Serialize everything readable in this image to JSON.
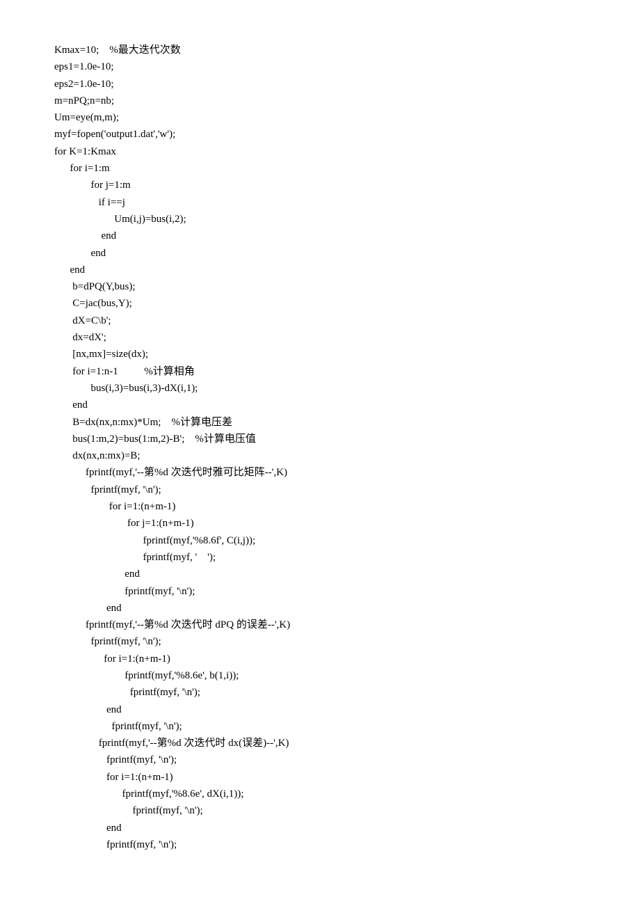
{
  "lines": [
    "Kmax=10;    %最大迭代次数",
    "eps1=1.0e-10;",
    "eps2=1.0e-10;",
    "m=nPQ;n=nb;",
    "Um=eye(m,m);",
    "myf=fopen('output1.dat','w');",
    "for K=1:Kmax",
    "      for i=1:m",
    "              for j=1:m",
    "                 if i==j",
    "                       Um(i,j)=bus(i,2);",
    "                  end",
    "              end",
    "      end",
    "       b=dPQ(Y,bus);",
    "       C=jac(bus,Y);",
    "       dX=C\\b';",
    "       dx=dX';",
    "       [nx,mx]=size(dx);",
    "       for i=1:n-1          %计算相角",
    "              bus(i,3)=bus(i,3)-dX(i,1);",
    "       end",
    "       B=dx(nx,n:mx)*Um;    %计算电压差",
    "       bus(1:m,2)=bus(1:m,2)-B';    %计算电压值",
    "       dx(nx,n:mx)=B;",
    "            fprintf(myf,'--第%d 次迭代时雅可比矩阵--',K)",
    "              fprintf(myf, '\\n');",
    "                     for i=1:(n+m-1)",
    "                            for j=1:(n+m-1)",
    "                                  fprintf(myf,'%8.6f', C(i,j));",
    "                                  fprintf(myf, '    ');",
    "                           end",
    "                           fprintf(myf, '\\n');",
    "                    end",
    "            fprintf(myf,'--第%d 次迭代时 dPQ 的误差--',K)",
    "              fprintf(myf, '\\n');",
    "                   for i=1:(n+m-1)",
    "                           fprintf(myf,'%8.6e', b(1,i));",
    "                             fprintf(myf, '\\n');",
    "                    end",
    "                      fprintf(myf, '\\n');",
    "                 fprintf(myf,'--第%d 次迭代时 dx(误差)--',K)",
    "                    fprintf(myf, '\\n');",
    "                    for i=1:(n+m-1)",
    "                          fprintf(myf,'%8.6e', dX(i,1));",
    "                              fprintf(myf, '\\n');",
    "                    end",
    "                    fprintf(myf, '\\n');"
  ]
}
